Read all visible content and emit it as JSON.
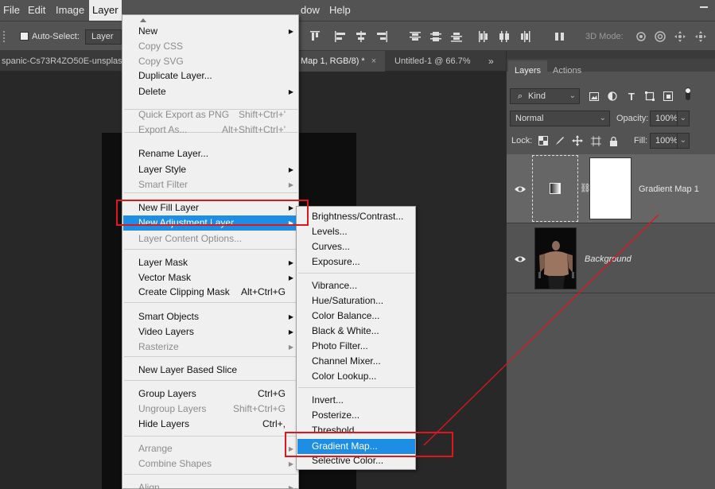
{
  "menubar": {
    "items": [
      "File",
      "Edit",
      "Image",
      "Layer",
      "Window",
      "Help"
    ],
    "visible_partial": [
      "dow"
    ]
  },
  "options": {
    "auto_select_label": "Auto-Select:",
    "auto_select_value": "Layer",
    "mode_label": "3D Mode:"
  },
  "tabs": [
    {
      "label": "spanic-Cs73R4ZO50E-unsplas"
    },
    {
      "label": "Map 1, RGB/8) *",
      "close": "×"
    },
    {
      "label": "Untitled-1 @ 66.7%"
    }
  ],
  "tab_more": "»",
  "panel": {
    "tabs": [
      "Layers",
      "Actions"
    ],
    "filter_kind": "Kind",
    "blend_mode": "Normal",
    "opacity_label": "Opacity:",
    "opacity_value": "100%",
    "lock_label": "Lock:",
    "fill_label": "Fill:",
    "fill_value": "100%",
    "layers": [
      {
        "name": "Gradient Map 1"
      },
      {
        "name": "Background"
      }
    ]
  },
  "layer_menu": [
    {
      "label": "New",
      "arrow": true
    },
    {
      "label": "Copy CSS",
      "disabled": true
    },
    {
      "label": "Copy SVG",
      "disabled": true
    },
    {
      "label": "Duplicate Layer..."
    },
    {
      "label": "Delete",
      "arrow": true
    },
    {
      "label": "Quick Export as PNG",
      "shortcut": "Shift+Ctrl+'",
      "disabled": true
    },
    {
      "label": "Export As...",
      "shortcut": "Alt+Shift+Ctrl+'",
      "disabled": true
    },
    {
      "label": "Rename Layer..."
    },
    {
      "label": "Layer Style",
      "arrow": true
    },
    {
      "label": "Smart Filter",
      "arrow": true,
      "disabled": true
    },
    {
      "label": "New Fill Layer",
      "arrow": true
    },
    {
      "label": "New Adjustment Layer",
      "arrow": true,
      "highlighted": true
    },
    {
      "label": "Layer Content Options...",
      "disabled": true
    },
    {
      "label": "Layer Mask",
      "arrow": true
    },
    {
      "label": "Vector Mask",
      "arrow": true
    },
    {
      "label": "Create Clipping Mask",
      "shortcut": "Alt+Ctrl+G"
    },
    {
      "label": "Smart Objects",
      "arrow": true
    },
    {
      "label": "Video Layers",
      "arrow": true
    },
    {
      "label": "Rasterize",
      "arrow": true,
      "disabled": true
    },
    {
      "label": "New Layer Based Slice"
    },
    {
      "label": "Group Layers",
      "shortcut": "Ctrl+G"
    },
    {
      "label": "Ungroup Layers",
      "shortcut": "Shift+Ctrl+G",
      "disabled": true
    },
    {
      "label": "Hide Layers",
      "shortcut": "Ctrl+,"
    },
    {
      "label": "Arrange",
      "arrow": true,
      "disabled": true
    },
    {
      "label": "Combine Shapes",
      "arrow": true,
      "disabled": true
    },
    {
      "label": "Align",
      "arrow": true,
      "disabled": true
    }
  ],
  "adjustment_menu": [
    {
      "label": "Brightness/Contrast..."
    },
    {
      "label": "Levels..."
    },
    {
      "label": "Curves..."
    },
    {
      "label": "Exposure..."
    },
    {
      "label": "Vibrance..."
    },
    {
      "label": "Hue/Saturation..."
    },
    {
      "label": "Color Balance..."
    },
    {
      "label": "Black & White..."
    },
    {
      "label": "Photo Filter..."
    },
    {
      "label": "Channel Mixer..."
    },
    {
      "label": "Color Lookup..."
    },
    {
      "label": "Invert..."
    },
    {
      "label": "Posterize..."
    },
    {
      "label": "Threshold..."
    },
    {
      "label": "Gradient Map...",
      "highlighted": true
    },
    {
      "label": "Selective Color..."
    }
  ],
  "colors": {
    "highlight": "#1e8ee4",
    "annotation": "#e0161b",
    "panel_bg": "#535353",
    "canvas_bg": "#282828"
  }
}
